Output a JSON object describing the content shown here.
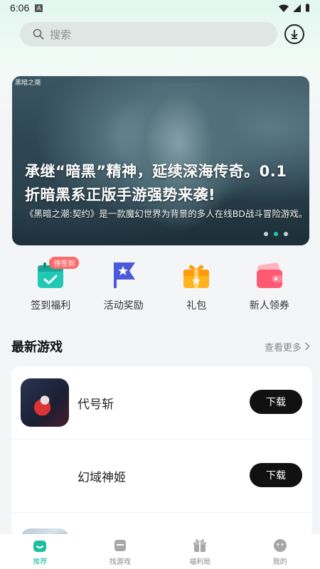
{
  "status_bar": {
    "time": "6:06",
    "notification_letter": "A"
  },
  "search": {
    "placeholder": "搜索"
  },
  "banner": {
    "logo_text": "黑暗之潮",
    "title_line1": "承继“暗黑”精神，延续深海传奇。0.1",
    "title_line2": "折暗黑系正版手游强势来袭!",
    "description": "《黑暗之潮:契约》是一款魔幻世界为背景的多人在线BD战斗冒险游戏。",
    "dots_total": 3,
    "active_dot": 2
  },
  "quick_actions": [
    {
      "label": "签到福利",
      "icon": "calendar-check-icon",
      "badge": "待签到"
    },
    {
      "label": "活动奖励",
      "icon": "star-flag-icon"
    },
    {
      "label": "礼包",
      "icon": "gift-box-icon"
    },
    {
      "label": "新人领券",
      "icon": "coupon-wallet-icon"
    }
  ],
  "latest_games": {
    "title": "最新游戏",
    "see_more": "查看更多",
    "games": [
      {
        "name": "代号斩",
        "button": "下载"
      },
      {
        "name": "幻域神姬",
        "button": "下载"
      }
    ]
  },
  "bottom_nav": [
    {
      "label": "推荐",
      "icon": "home-icon",
      "active": true
    },
    {
      "label": "找游戏",
      "icon": "gamepad-box-icon",
      "active": false
    },
    {
      "label": "福利局",
      "icon": "gift-icon",
      "active": false
    },
    {
      "label": "我的",
      "icon": "profile-face-icon",
      "active": false
    }
  ],
  "colors": {
    "accent": "#1fbf9d",
    "badge": "#ff6a6a",
    "download_button": "#111111"
  }
}
